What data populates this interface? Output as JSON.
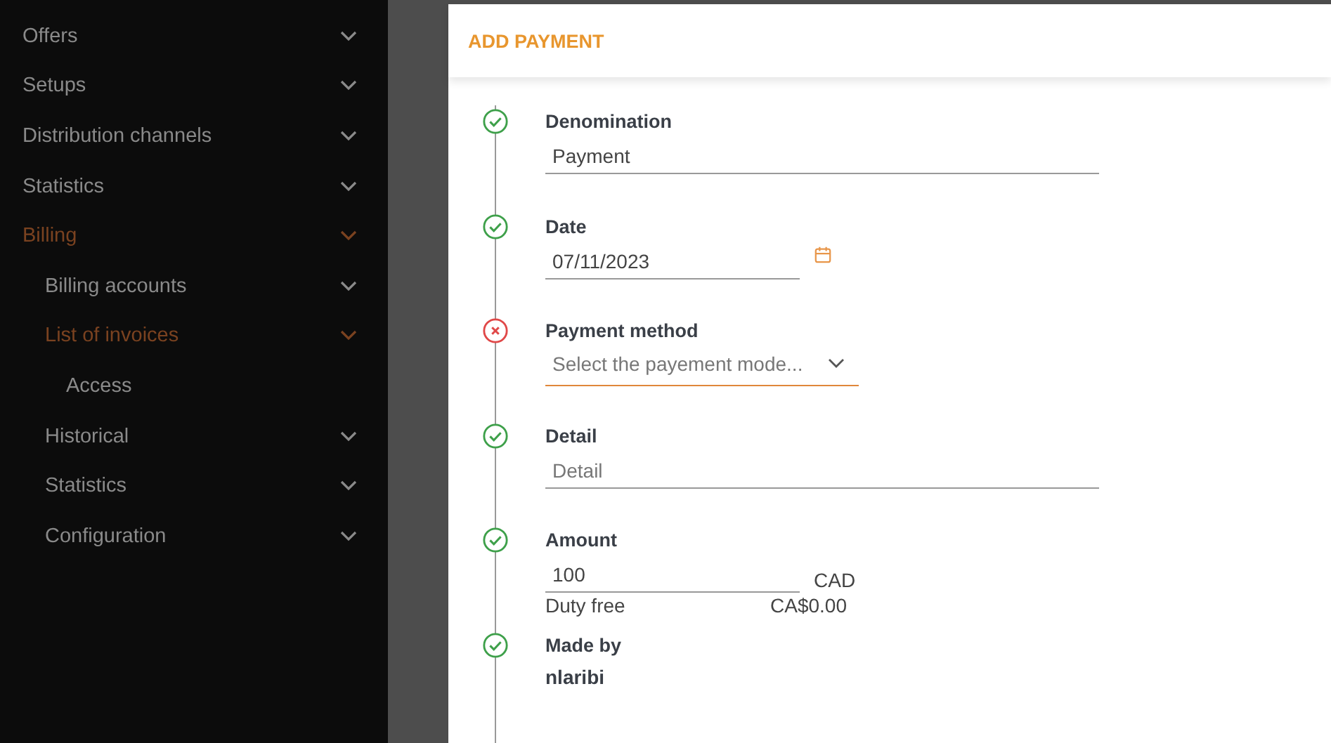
{
  "sidebar": {
    "items": [
      {
        "label": "Offers",
        "selected": false
      },
      {
        "label": "Setups",
        "selected": false
      },
      {
        "label": "Distribution channels",
        "selected": false
      },
      {
        "label": "Statistics",
        "selected": false
      },
      {
        "label": "Billing",
        "selected": true,
        "children": [
          {
            "label": "Billing accounts",
            "selected": false
          },
          {
            "label": "List of invoices",
            "selected": true,
            "children": [
              {
                "label": "Access",
                "selected": false
              }
            ]
          },
          {
            "label": "Historical",
            "selected": false
          },
          {
            "label": "Statistics",
            "selected": false
          },
          {
            "label": "Configuration",
            "selected": false
          }
        ]
      }
    ]
  },
  "dialog": {
    "title": "ADD PAYMENT",
    "steps": [
      {
        "label": "Denomination",
        "valid": true,
        "kind": "text",
        "value": "Payment"
      },
      {
        "label": "Date",
        "valid": true,
        "kind": "date",
        "value": "07/11/2023"
      },
      {
        "label": "Payment method",
        "valid": false,
        "kind": "select",
        "placeholder": "Select the payement mode..."
      },
      {
        "label": "Detail",
        "valid": true,
        "kind": "text",
        "placeholder": "Detail"
      },
      {
        "label": "Amount",
        "valid": true,
        "kind": "amount",
        "value": "100",
        "currency": "CAD",
        "note": "Duty free",
        "note_value": "CA$0.00"
      },
      {
        "label": "Made by",
        "valid": true,
        "kind": "static",
        "value": "nlaribi"
      }
    ]
  }
}
